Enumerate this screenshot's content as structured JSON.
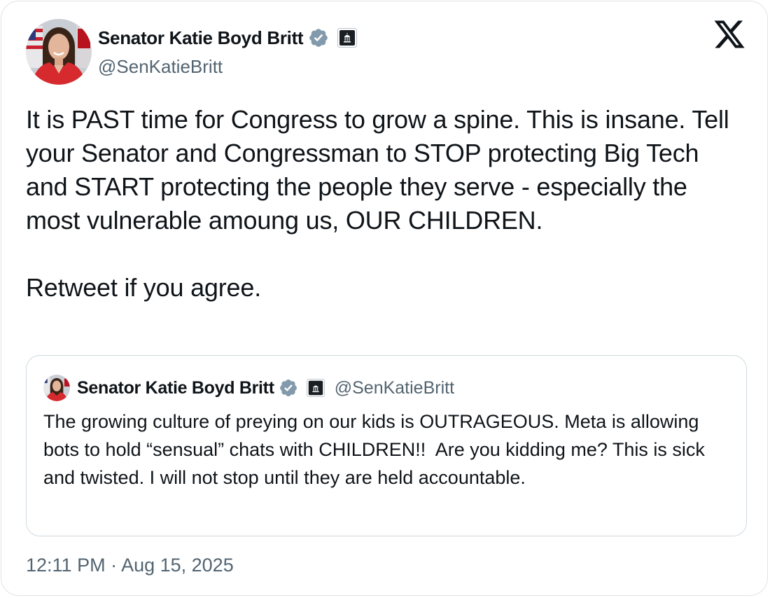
{
  "author": {
    "display_name": "Senator Katie Boyd Britt",
    "handle": "@SenKatieBritt"
  },
  "tweet": {
    "paragraphs": [
      "It is PAST time for Congress to grow a spine. This is insane. Tell your Senator and Congressman to STOP protecting Big Tech and START protecting the people they serve - especially the most vulnerable amoung us, OUR CHILDREN.",
      "Retweet if you agree."
    ],
    "timestamp": "12:11 PM · Aug 15, 2025"
  },
  "quoted_tweet": {
    "display_name": "Senator Katie Boyd Britt",
    "handle": "@SenKatieBritt",
    "text": "The growing culture of preying on our kids is OUTRAGEOUS. Meta is allowing bots to hold “sensual” chats with CHILDREN!!  Are you kidding me? This is sick and twisted. I will not stop until they are held accountable."
  },
  "icons": {
    "verified": "verified-badge-icon",
    "government": "government-affiliation-icon",
    "brand": "x-logo-icon"
  },
  "colors": {
    "text_primary": "#0f1419",
    "text_secondary": "#536471",
    "verified_badge": "#829aab",
    "border": "#cfd9de"
  }
}
